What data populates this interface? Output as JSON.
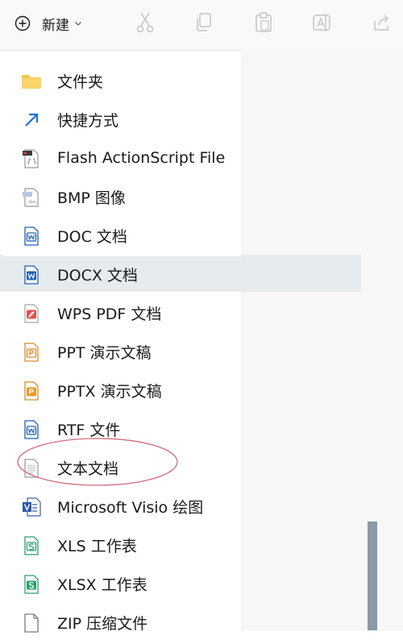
{
  "toolbar": {
    "new_label": "新建",
    "icons": [
      "plus-circle-icon",
      "chevron-down-icon",
      "cut-icon",
      "copy-icon",
      "paste-icon",
      "rename-icon",
      "share-icon"
    ]
  },
  "menu": {
    "items": [
      {
        "label": "文件夹",
        "icon": "folder-icon"
      },
      {
        "label": "快捷方式",
        "icon": "shortcut-arrow-icon"
      },
      {
        "label": "Flash ActionScript File",
        "icon": "actionscript-file-icon"
      },
      {
        "label": "BMP 图像",
        "icon": "bmp-image-icon"
      },
      {
        "label": "DOC 文档",
        "icon": "doc-icon"
      },
      {
        "label": "DOCX 文档",
        "icon": "docx-icon"
      },
      {
        "label": "WPS PDF 文档",
        "icon": "pdf-icon"
      },
      {
        "label": "PPT 演示文稿",
        "icon": "ppt-icon"
      },
      {
        "label": "PPTX 演示文稿",
        "icon": "pptx-icon"
      },
      {
        "label": "RTF 文件",
        "icon": "rtf-icon"
      },
      {
        "label": "文本文档",
        "icon": "text-document-icon"
      },
      {
        "label": "Microsoft Visio 绘图",
        "icon": "visio-icon"
      },
      {
        "label": "XLS 工作表",
        "icon": "xls-icon"
      },
      {
        "label": "XLSX 工作表",
        "icon": "xlsx-icon"
      },
      {
        "label": "ZIP 压缩文件",
        "icon": "zip-icon"
      }
    ],
    "highlighted_index": 5,
    "annotated_index": 10
  },
  "colors": {
    "toolbar_bg": "#f9f9f9",
    "accent": "#1e5fb4",
    "hover": "#e6ebf0",
    "annotation": "#d36a7a"
  }
}
